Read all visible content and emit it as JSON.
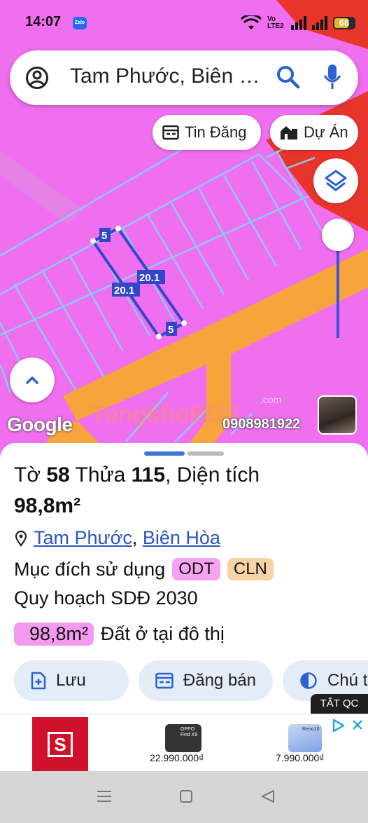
{
  "status_bar": {
    "time": "14:07",
    "zalo_label": "Zalo",
    "network": "Vo LTE2",
    "battery": "68"
  },
  "search": {
    "query": "Tam Phước, Biên …"
  },
  "chips": {
    "listings": "Tin Đăng",
    "projects": "Dự Án"
  },
  "map": {
    "parcel_labels": [
      "5",
      "20.1",
      "20.1",
      "5"
    ],
    "google_label": "Google",
    "watermark": "TongkhoBDS",
    "watermark_suffix": ".com",
    "phone": "0908981922",
    "colors": {
      "residential": "#f06ef0",
      "road": "#f7a43c",
      "red_zone": "#e8352c",
      "parcel_line": "#8ec7ef",
      "selected_parcel": "#3346c9"
    }
  },
  "sheet": {
    "title_prefix": "Tờ",
    "sheet_no": "58",
    "title_mid": "Thửa",
    "parcel_no": "115",
    "title_suffix": ", Diện tích",
    "area": "98,8m²",
    "ward": "Tam Phước",
    "separator": ",",
    "city": "Biên Hòa",
    "purpose_label": "Mục đích sử dụng",
    "tags": [
      {
        "text": "ODT",
        "bg": "#f7a3f2"
      },
      {
        "text": "CLN",
        "bg": "#f8d3a6"
      }
    ],
    "plan_label": "Quy hoạch SDĐ 2030",
    "zone_area": "98,8m²",
    "zone_desc": "Đất ở tại đô thị"
  },
  "actions": {
    "save": "Lưu",
    "post": "Đăng bán",
    "note": "Chú t"
  },
  "ad": {
    "close_label": "TẮT QC",
    "brand_letter": "S",
    "phone1_label": "OPPO Find X9",
    "price1": "22.990.000₫",
    "phone2_label": "Reno10",
    "price2": "7.990.000₫"
  }
}
